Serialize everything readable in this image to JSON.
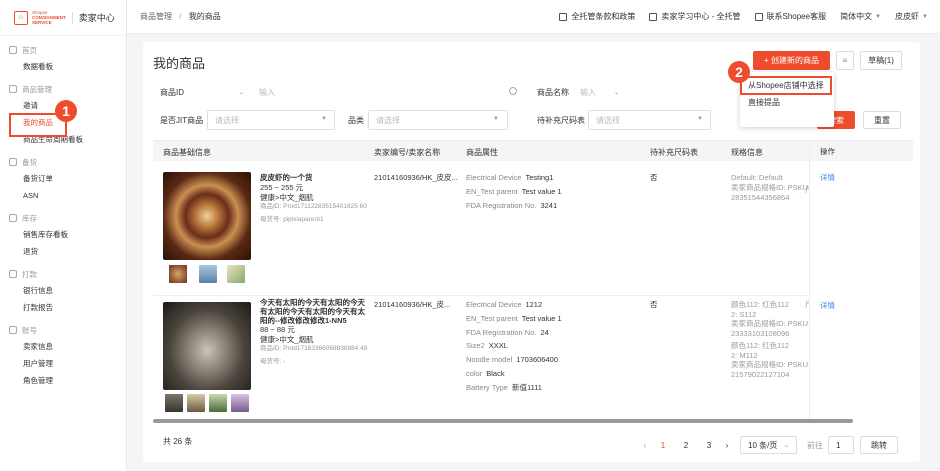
{
  "brand": {
    "logo_top": "Shopee",
    "logo_line1": "CONSIGNMENT",
    "logo_line2": "SERVICE",
    "title": "卖家中心",
    "accent": "#ee4d2d"
  },
  "sidebar": {
    "groups": [
      {
        "head": "首页",
        "icon": "home-icon",
        "items": [
          "数据看板"
        ]
      },
      {
        "head": "商品管理",
        "icon": "box-icon",
        "items": [
          "邀请",
          "我的商品",
          "商品生命周期看板"
        ]
      },
      {
        "head": "备货",
        "icon": "truck-icon",
        "items": [
          "备货订单",
          "ASN"
        ]
      },
      {
        "head": "库存",
        "icon": "warehouse-icon",
        "items": [
          "销售库存看板",
          "退货"
        ]
      },
      {
        "head": "打款",
        "icon": "wallet-icon",
        "items": [
          "银行信息",
          "打款报告"
        ]
      },
      {
        "head": "账号",
        "icon": "user-icon",
        "items": [
          "卖家信息",
          "用户管理",
          "角色管理"
        ]
      }
    ],
    "active_item": "我的商品"
  },
  "callouts": {
    "one": "1",
    "two": "2"
  },
  "topbar": {
    "breadcrumb_parent": "商品管理",
    "breadcrumb_sep": "/",
    "breadcrumb_current": "我的商品",
    "link_policy": "全托管条款和政策",
    "link_learning": "卖家学习中心 - 全托管",
    "link_support": "联系Shopee客服",
    "language": "简体中文",
    "user": "皮皮虾"
  },
  "page": {
    "title": "我的商品",
    "create_button": "+ 创建新的商品",
    "draft_button": "草稿(1)",
    "dropdown_items": [
      "从Shopee店铺中选择",
      "直接提品"
    ]
  },
  "filters": {
    "product_id_label": "商品ID",
    "product_id_placeholder": "输入",
    "product_name_label": "商品名称",
    "product_name_placeholder": "输入",
    "jit_label": "是否JIT商品",
    "jit_placeholder": "请选择",
    "category_label": "品类",
    "category_placeholder": "请选择",
    "size_chart_label": "待补充尺码表",
    "size_chart_placeholder": "请选择",
    "search_button": "搜索",
    "reset_button": "重置"
  },
  "table": {
    "columns": [
      "商品基础信息",
      "卖家编号/卖家名称",
      "商品属性",
      "待补充尺码表",
      "规格信息",
      "操作"
    ],
    "rows": [
      {
        "name": "皮皮虾的一个货",
        "price": "255 ~ 255 元",
        "category": "健康>中文_烟肌",
        "product_id": "商品ID: Prod17112283515401625 60",
        "parent_sku": "母货号: pipixiaparent1",
        "seller": "21014160936/HK_皮皮...",
        "attrs": [
          {
            "k": "Electrical Device",
            "v": "Testing1"
          },
          {
            "k": "EN_Test parent",
            "v": "Test value 1"
          },
          {
            "k": "FDA Registration No.",
            "v": "3241"
          }
        ],
        "size_chart": "否",
        "spec_lines": [
          "Default: Default",
          "卖家商品规格ID: PSKU1",
          "28351544356864"
        ],
        "spec_extra": "尺",
        "action": "详情"
      },
      {
        "name": "今天有太阳的今天有太阳的今天有太阳的今天有太阳的今天有太阳的--修改修改修改1-NN5",
        "price": "88 ~ 88 元",
        "category": "健康>中文_烟肌",
        "product_id": "商品ID: Prod17163366068836884 48",
        "parent_sku": "母货号: -",
        "seller": "21014160936/HK_皮...",
        "attrs": [
          {
            "k": "Electrical Device",
            "v": "1212"
          },
          {
            "k": "EN_Test parent",
            "v": "Test value 1"
          },
          {
            "k": "FDA Registration No.",
            "v": "24"
          },
          {
            "k": "Size2",
            "v": "XXXL"
          },
          {
            "k": "Noodle model",
            "v": "1703606400"
          },
          {
            "k": "color",
            "v": "Black"
          },
          {
            "k": "Battery Type",
            "v": "新值1111"
          }
        ],
        "size_chart": "否",
        "spec_lines": [
          "颜色112: 红色112",
          "2: S112",
          "卖家商品规格ID: PSKU1",
          "23333103108096",
          "颜色112: 红色112",
          "2: M112",
          "卖家商品规格ID: PSKU1",
          "21579022127104"
        ],
        "spec_extra": "尺",
        "action": "详情"
      }
    ]
  },
  "pagination": {
    "total": "共 26 条",
    "prev": "‹",
    "pages": [
      "1",
      "2",
      "3"
    ],
    "next": "›",
    "page_size": "10 条/页",
    "goto_label": "前往",
    "goto_value": "1",
    "goto_button": "跳转"
  }
}
